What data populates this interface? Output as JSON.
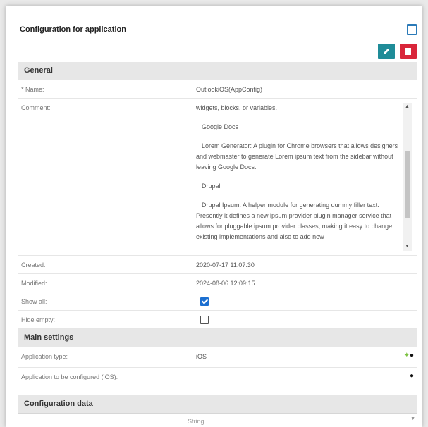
{
  "header": {
    "title": "Configuration for application"
  },
  "toolbar": {
    "edit_label": "Edit",
    "delete_label": "Delete"
  },
  "general": {
    "section_title": "General",
    "name_label": "* Name:",
    "name_value": "OutlookiOS(AppConfig)",
    "comment_label": "Comment:",
    "comment_paragraphs": [
      "widgets, blocks, or variables.",
      "Google Docs",
      "Lorem Generator: A plugin for Chrome browsers that allows designers and webmaster to generate Lorem ipsum text from the sidebar without leaving Google Docs.",
      "Drupal",
      "Drupal Ipsum: A helper module for generating dummy filler text. Presently it defines a new ipsum provider plugin manager service that allows for pluggable ipsum provider classes, making it easy to change existing implementations and also to add new"
    ],
    "created_label": "Created:",
    "created_value": "2020-07-17 11:07:30",
    "modified_label": "Modified:",
    "modified_value": "2024-08-06 12:09:15",
    "show_all_label": "Show all:",
    "show_all_checked": true,
    "hide_empty_label": "Hide empty:",
    "hide_empty_checked": false
  },
  "main_settings": {
    "section_title": "Main settings",
    "app_type_label": "Application type:",
    "app_type_value": "iOS",
    "app_configured_label": "Application to be configured (iOS):"
  },
  "configuration_data": {
    "section_title": "Configuration data",
    "column_header": "String"
  },
  "colors": {
    "edit_button": "#1f8c98",
    "delete_button": "#d9263a",
    "checkbox_checked": "#1c6fd0",
    "android_icon": "#7cc242"
  },
  "icons": [
    "window-icon",
    "edit-icon",
    "trash-icon",
    "android-icon",
    "apple-icon",
    "scroll-up-icon",
    "scroll-down-icon"
  ]
}
